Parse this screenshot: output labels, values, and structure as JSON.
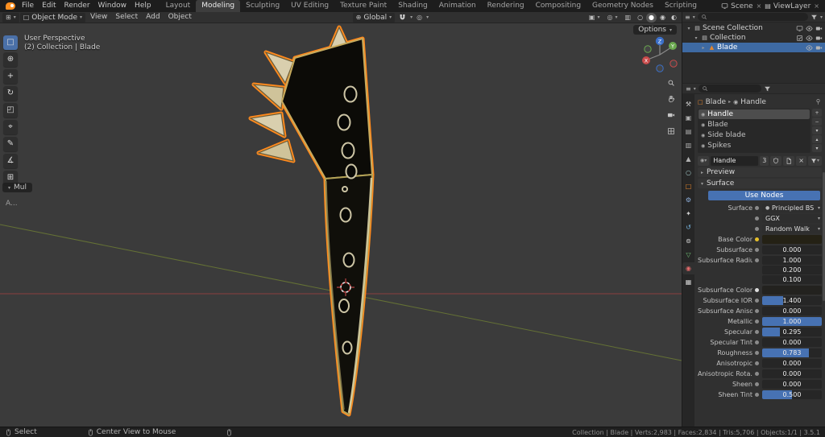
{
  "topbar": {
    "menus": [
      "File",
      "Edit",
      "Render",
      "Window",
      "Help"
    ],
    "workspaces": [
      "Layout",
      "Modeling",
      "Sculpting",
      "UV Editing",
      "Texture Paint",
      "Shading",
      "Animation",
      "Rendering",
      "Compositing",
      "Geometry Nodes",
      "Scripting"
    ],
    "active_workspace": "Modeling",
    "scene": "Scene",
    "view_layer": "ViewLayer"
  },
  "viewport_header": {
    "mode": "Object Mode",
    "menus": [
      "View",
      "Select",
      "Add",
      "Object"
    ],
    "orientation": "Global",
    "options_label": "Options"
  },
  "viewport": {
    "persp_label": "User Perspective",
    "collection_label": "(2) Collection | Blade",
    "operator_label": "Mul",
    "annotation_label": "A...",
    "selection_outline_color": "#ff8a1d"
  },
  "toolbar": {
    "tools": [
      {
        "name": "select-box-tool",
        "glyph": "□",
        "active": true
      },
      {
        "name": "cursor-tool",
        "glyph": "⊕"
      },
      {
        "name": "move-tool",
        "glyph": "+"
      },
      {
        "name": "rotate-tool",
        "glyph": "↻"
      },
      {
        "name": "scale-tool",
        "glyph": "◰"
      },
      {
        "name": "transform-tool",
        "glyph": "⌖"
      },
      {
        "name": "annotate-tool",
        "glyph": "✎"
      },
      {
        "name": "measure-tool",
        "glyph": "∡"
      },
      {
        "name": "add-cube-tool",
        "glyph": "⊞"
      }
    ]
  },
  "outliner": {
    "rows": [
      {
        "label": "Scene Collection",
        "tri": "▾",
        "icon": "collection",
        "level": 0,
        "right_icons": [
          "monitor",
          "eye",
          "camera"
        ]
      },
      {
        "label": "Collection",
        "tri": "▾",
        "icon": "collection",
        "level": 1,
        "right_icons": [
          "checkbox",
          "eye",
          "camera"
        ]
      },
      {
        "label": "Blade",
        "tri": "▸",
        "icon": "mesh",
        "level": 2,
        "selected": true,
        "right_icons": [
          "eye",
          "camera"
        ]
      }
    ]
  },
  "properties": {
    "tabs": [
      {
        "name": "tool",
        "glyph": "⚒",
        "color": "#c8c8c8"
      },
      {
        "name": "render",
        "glyph": "▣",
        "color": "#b0b0b0"
      },
      {
        "name": "output",
        "glyph": "▤",
        "color": "#b0b0b0"
      },
      {
        "name": "view-layer",
        "glyph": "▥",
        "color": "#b0b0b0"
      },
      {
        "name": "scene",
        "glyph": "▲",
        "color": "#b0b0b0"
      },
      {
        "name": "world",
        "glyph": "○",
        "color": "#9fc4c4"
      },
      {
        "name": "object",
        "glyph": "□",
        "color": "#e8872b"
      },
      {
        "name": "modifiers",
        "glyph": "⚙",
        "color": "#8fb1dd"
      },
      {
        "name": "particles",
        "glyph": "✦",
        "color": "#cfcfcf"
      },
      {
        "name": "physics",
        "glyph": "↺",
        "color": "#79b8e3"
      },
      {
        "name": "constraints",
        "glyph": "⊚",
        "color": "#cfcfcf"
      },
      {
        "name": "data",
        "glyph": "▽",
        "color": "#6fbf74"
      },
      {
        "name": "material",
        "glyph": "◉",
        "color": "#e06a6a",
        "active": true
      },
      {
        "name": "texture",
        "glyph": "▦",
        "color": "#cfcfcf"
      }
    ],
    "breadcrumb": {
      "object": "Blade",
      "material": "Handle"
    },
    "slots": [
      {
        "name": "Handle",
        "selected": true
      },
      {
        "name": "Blade"
      },
      {
        "name": "Side blade"
      },
      {
        "name": "Spikes"
      }
    ],
    "material_name": "Handle",
    "material_users": "3",
    "preview_label": "Preview",
    "surface_label": "Surface",
    "use_nodes_label": "Use Nodes",
    "accent_color": "#4772b3",
    "rows": [
      {
        "label": "Surface",
        "type": "preset",
        "value": "Principled BSDF"
      },
      {
        "label": "",
        "type": "dropdown",
        "value": "GGX"
      },
      {
        "label": "",
        "type": "dropdown",
        "value": "Random Walk"
      },
      {
        "label": "Base Color",
        "type": "color",
        "dot": "#e6c02a",
        "swatch": "#242115"
      },
      {
        "label": "Subsurface",
        "type": "slider",
        "value": "0.000",
        "frac": 0
      },
      {
        "label": "Subsurface Radius",
        "type": "field3",
        "values": [
          "1.000",
          "0.200",
          "0.100"
        ]
      },
      {
        "label": "Subsurface Color",
        "type": "color",
        "dot": "#dcdcdc",
        "swatch": "#23221f"
      },
      {
        "label": "Subsurface IOR",
        "type": "slider",
        "value": "1.400",
        "frac": 0.35
      },
      {
        "label": "Subsurface Aniso...",
        "type": "slider",
        "value": "0.000",
        "frac": 0
      },
      {
        "label": "Metallic",
        "type": "slider",
        "value": "1.000",
        "frac": 1
      },
      {
        "label": "Specular",
        "type": "slider",
        "value": "0.295",
        "frac": 0.3
      },
      {
        "label": "Specular Tint",
        "type": "slider",
        "value": "0.000",
        "frac": 0
      },
      {
        "label": "Roughness",
        "type": "slider",
        "value": "0.783",
        "frac": 0.78
      },
      {
        "label": "Anisotropic",
        "type": "slider",
        "value": "0.000",
        "frac": 0
      },
      {
        "label": "Anisotropic Rota...",
        "type": "slider",
        "value": "0.000",
        "frac": 0
      },
      {
        "label": "Sheen",
        "type": "slider",
        "value": "0.000",
        "frac": 0
      },
      {
        "label": "Sheen Tint",
        "type": "slider",
        "value": "0.500",
        "frac": 0.5
      }
    ]
  },
  "statusbar": {
    "left_hint": "Select",
    "mid_hint": "Center View to Mouse",
    "stats": "Collection | Blade | Verts:2,983 | Faces:2,834 | Tris:5,706 | Objects:1/1 | 3.5.1"
  }
}
